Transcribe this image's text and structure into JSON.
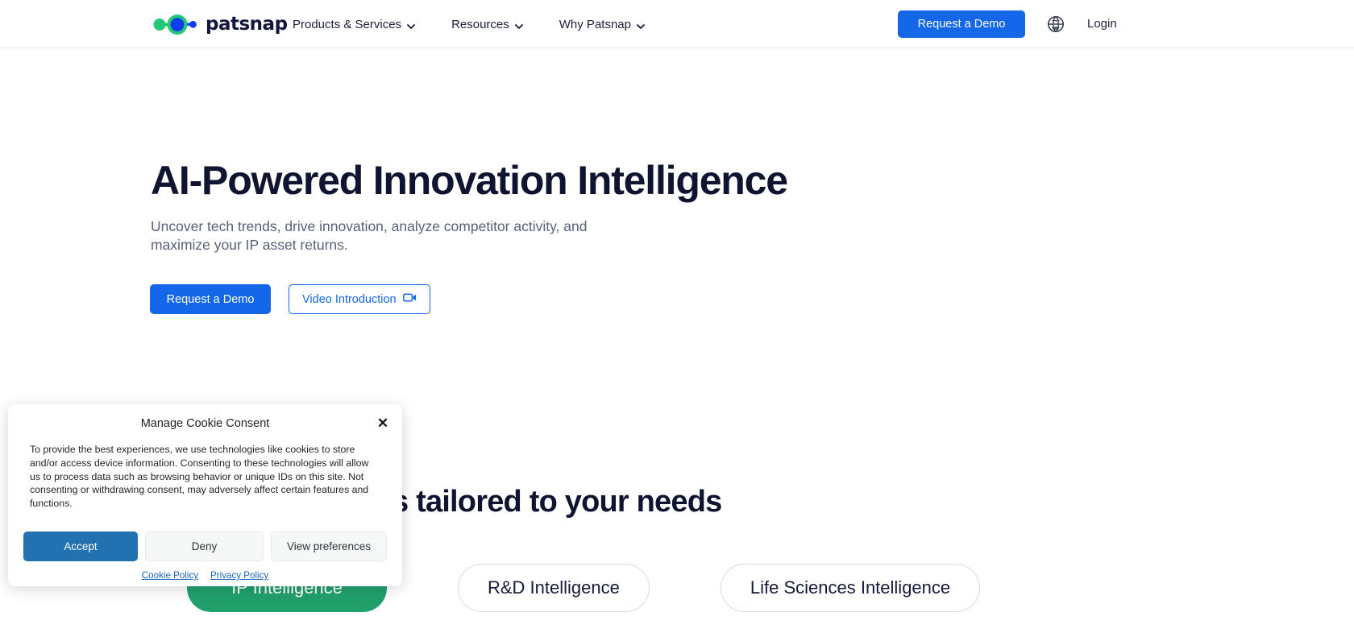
{
  "header": {
    "brand": {
      "wordmark": "patsnap",
      "logo_green": "#25c878",
      "logo_blue": "#0c3ef0"
    },
    "nav": [
      {
        "label": "Products & Services",
        "has_dropdown": true,
        "icon": "chevron-down-icon"
      },
      {
        "label": "Resources",
        "has_dropdown": true,
        "icon": "chevron-down-icon"
      },
      {
        "label": "Why Patsnap",
        "has_dropdown": true,
        "icon": "chevron-down-icon"
      }
    ],
    "demo_button": "Request a Demo",
    "language_icon": "globe-icon",
    "login_label": "Login",
    "accent_blue": "#1367e8"
  },
  "hero": {
    "title": "AI-Powered Innovation Intelligence",
    "subtitle": "Uncover tech trends, drive innovation, analyze competitor activity, and maximize your IP asset returns.",
    "primary_button": "Request a Demo",
    "secondary_button": "Video Introduction",
    "secondary_button_icon": "video-camera-icon"
  },
  "solutions": {
    "title": "olutions tailored to your needs",
    "full_title": "Solutions tailored to your needs",
    "pills": [
      {
        "label": "IP Intelligence",
        "active": true,
        "color": "#21a06c"
      },
      {
        "label": "R&D Intelligence",
        "active": false
      },
      {
        "label": "Life Sciences Intelligence",
        "active": false
      }
    ]
  },
  "cookie_consent": {
    "title": "Manage Cookie Consent",
    "close_icon": "close-icon",
    "body": "To provide the best experiences, we use technologies like cookies to store and/or access device information. Consenting to these technologies will allow us to process data such as browsing behavior or unique IDs on this site. Not consenting or withdrawing consent, may adversely affect certain features and functions.",
    "accept_label": "Accept",
    "deny_label": "Deny",
    "preferences_label": "View preferences",
    "cookie_policy_label": "Cookie Policy",
    "privacy_policy_label": "Privacy Policy",
    "accept_color": "#2271b1"
  }
}
